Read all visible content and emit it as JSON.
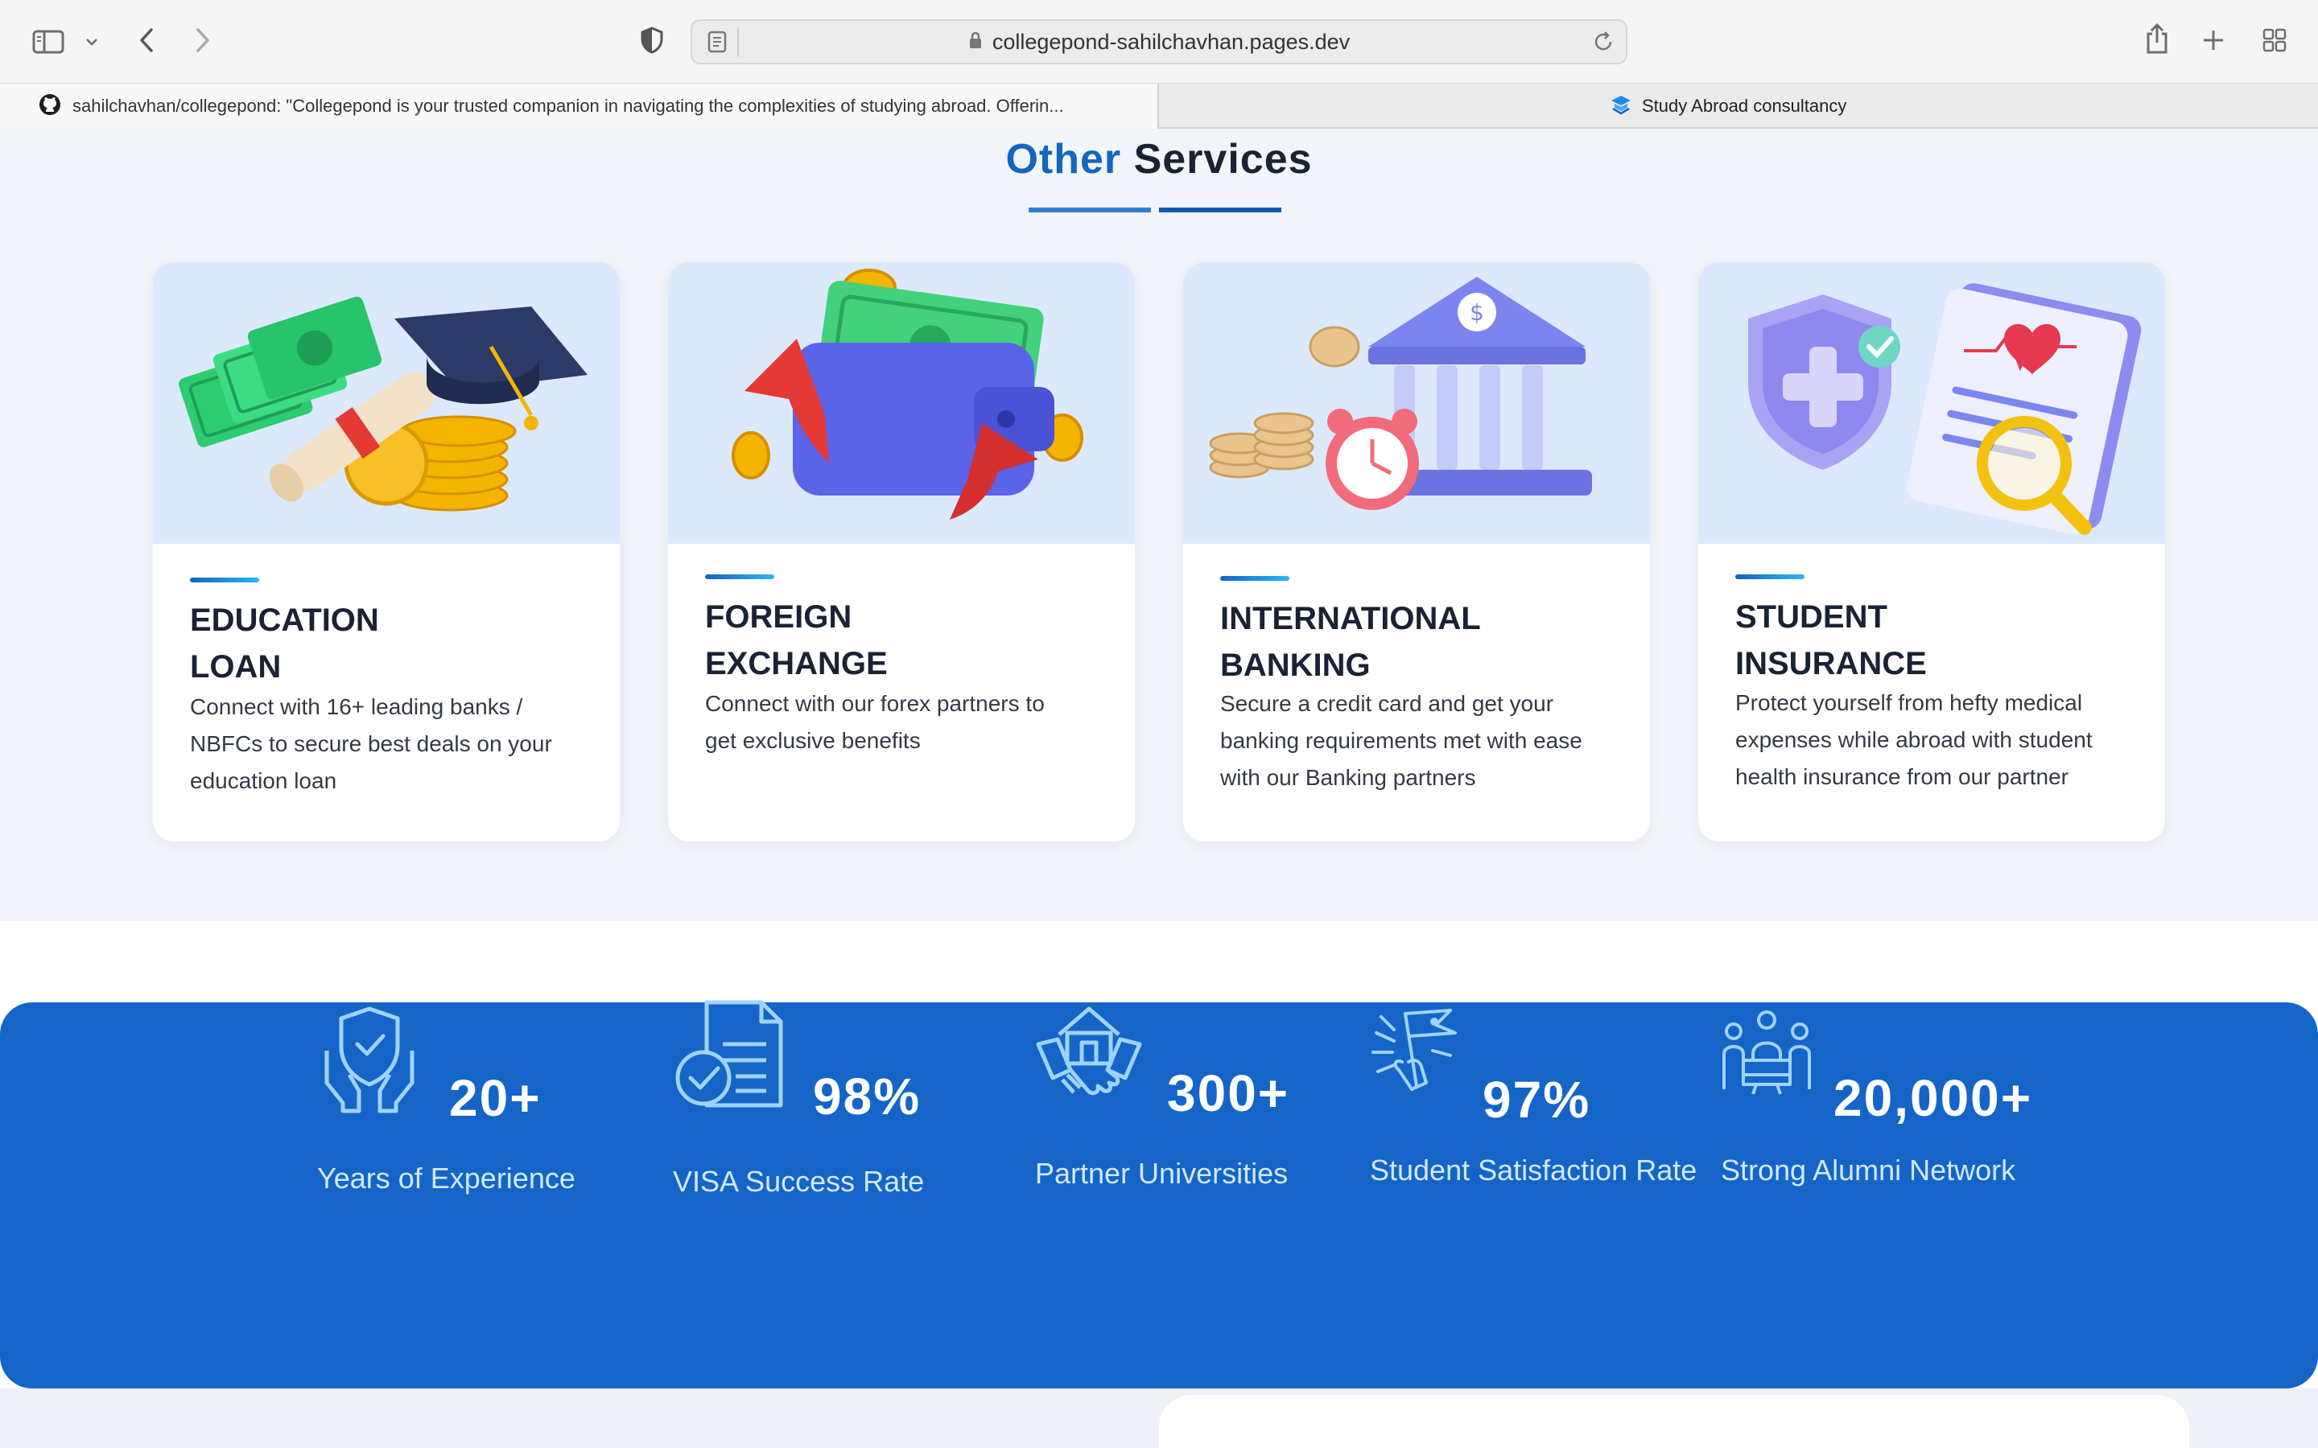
{
  "browser": {
    "url": "collegepond-sahilchavhan.pages.dev",
    "tabs": [
      {
        "title": "sahilchavhan/collegepond: \"Collegepond is your trusted companion in navigating the complexities of studying abroad. Offerin...",
        "icon": "github-icon"
      },
      {
        "title": "Study Abroad consultancy",
        "icon": "collegepond-logo-icon"
      }
    ]
  },
  "services": {
    "title_accent": "Other",
    "title_rest": "Services",
    "accent_color": "#1565c0",
    "cards": [
      {
        "title_line1": "EDUCATION",
        "title_line2": "LOAN",
        "desc_line1": "Connect with 16+ leading banks /",
        "desc_line2": "NBFCs to secure best deals on your",
        "desc_line3": "education loan",
        "illustration": "money-graduation-cap-illustration"
      },
      {
        "title_line1": "FOREIGN",
        "title_line2": "EXCHANGE",
        "desc_line1": "Connect with our forex partners to",
        "desc_line2": "get exclusive benefits",
        "desc_line3": "",
        "illustration": "wallet-exchange-illustration"
      },
      {
        "title_line1": "INTERNATIONAL",
        "title_line2": "BANKING",
        "desc_line1": "Secure a credit card and get your",
        "desc_line2": "banking requirements met with ease",
        "desc_line3": "with our Banking partners",
        "illustration": "bank-clock-coins-illustration"
      },
      {
        "title_line1": "STUDENT",
        "title_line2": "INSURANCE",
        "desc_line1": "Protect yourself from hefty medical",
        "desc_line2": "expenses while abroad with student",
        "desc_line3": "health insurance from our partner",
        "illustration": "insurance-document-shield-illustration"
      }
    ]
  },
  "stats": [
    {
      "value": "20+",
      "label": "Years of Experience",
      "icon": "shield-hands-icon"
    },
    {
      "value": "98%",
      "label": "VISA Success Rate",
      "icon": "document-check-icon"
    },
    {
      "value": "300+",
      "label": "Partner Universities",
      "icon": "handshake-building-icon"
    },
    {
      "value": "97%",
      "label": "Student Satisfaction Rate",
      "icon": "celebration-flag-icon"
    },
    {
      "value": "20,000+",
      "label": "Strong Alumni Network",
      "icon": "people-network-icon"
    }
  ]
}
